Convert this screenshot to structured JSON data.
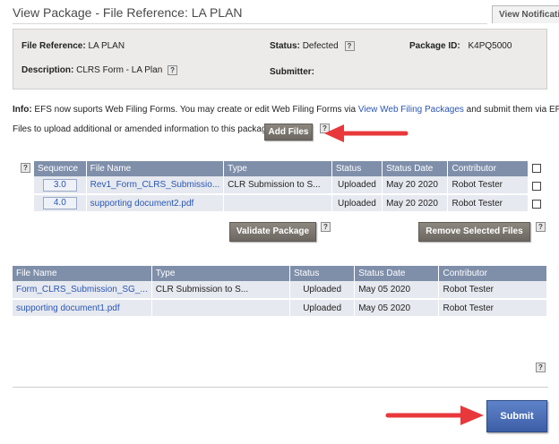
{
  "header": {
    "title": "View Package - File Reference: LA PLAN",
    "view_notifications": "View Notificati"
  },
  "package_info": {
    "file_reference_label": "File Reference:",
    "file_reference_value": "LA PLAN",
    "status_label": "Status:",
    "status_value": "Defected",
    "package_id_label": "Package ID:",
    "package_id_value": "K4PQ5000",
    "description_label": "Description:",
    "description_value": "CLRS Form - LA Plan",
    "submitter_label": "Submitter:",
    "submitter_value": ""
  },
  "info_text": {
    "label": "Info:",
    "text_before": " EFS now suports Web Filing Forms. You may create or edit Web Filing Forms via ",
    "link": "View Web Filing Packages",
    "text_after": " and submit them via EFS.",
    "upload_text": "Files to upload additional or amended information to this package."
  },
  "buttons": {
    "add_files": "Add Files",
    "validate_package": "Validate Package",
    "remove_selected_files": "Remove Selected Files",
    "submit": "Submit"
  },
  "help_glyph": "?",
  "new_files_table": {
    "headers": [
      "Sequence",
      "File Name",
      "Type",
      "Status",
      "Status Date",
      "Contributor"
    ],
    "rows": [
      {
        "sequence": "3.0",
        "file_name": "Rev1_Form_CLRS_Submissio...",
        "type": "CLR Submission to S...",
        "status": "Uploaded",
        "status_date": "May 20 2020",
        "contributor": "Robot Tester"
      },
      {
        "sequence": "4.0",
        "file_name": "supporting document2.pdf",
        "type": "",
        "status": "Uploaded",
        "status_date": "May 20 2020",
        "contributor": "Robot Tester"
      }
    ]
  },
  "existing_files_table": {
    "headers": [
      "File Name",
      "Type",
      "Status",
      "Status Date",
      "Contributor"
    ],
    "rows": [
      {
        "file_name": "Form_CLRS_Submission_SG_...",
        "type": "CLR Submission to S...",
        "status": "Uploaded",
        "status_date": "May 05 2020",
        "contributor": "Robot Tester"
      },
      {
        "file_name": "supporting document1.pdf",
        "type": "",
        "status": "Uploaded",
        "status_date": "May 05 2020",
        "contributor": "Robot Tester"
      }
    ]
  },
  "colors": {
    "table_header": "#7f8faa",
    "link": "#2a56b4",
    "arrow": "#e8383b",
    "submit": "#3c5ea6"
  }
}
